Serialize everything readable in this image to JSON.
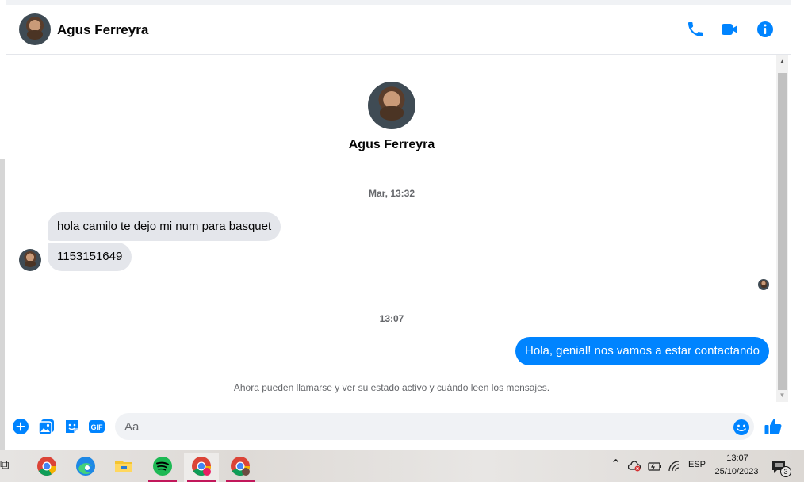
{
  "header": {
    "contact_name": "Agus Ferreyra",
    "icons": [
      "phone-icon",
      "video-icon",
      "info-icon"
    ]
  },
  "profile": {
    "name": "Agus Ferreyra"
  },
  "conversation": {
    "timestamps": [
      "Mar, 13:32",
      "13:07"
    ],
    "messages": [
      {
        "direction": "incoming",
        "text": "hola camilo te dejo mi num para basquet"
      },
      {
        "direction": "incoming",
        "text": "1153151649"
      },
      {
        "direction": "outgoing",
        "text": "Hola, genial! nos vamos a estar contactando"
      }
    ],
    "system_notice": "Ahora pueden llamarse y ver su estado activo y cuándo leen los mensajes."
  },
  "composer": {
    "placeholder": "Aa",
    "icons": [
      "add-icon",
      "photo-icon",
      "sticker-icon",
      "gif-icon",
      "emoji-icon",
      "like-icon"
    ],
    "gif_label": "GIF"
  },
  "colors": {
    "accent": "#0084ff",
    "incoming_bubble": "#e4e6eb",
    "text_secondary": "#65676b"
  },
  "taskbar": {
    "apps": [
      "chrome-icon",
      "edge-icon",
      "file-explorer-icon",
      "spotify-icon",
      "chrome-profile-icon",
      "chrome-profile-icon"
    ],
    "language": "ESP",
    "time": "13:07",
    "date": "25/10/2023",
    "notification_count": "3"
  }
}
